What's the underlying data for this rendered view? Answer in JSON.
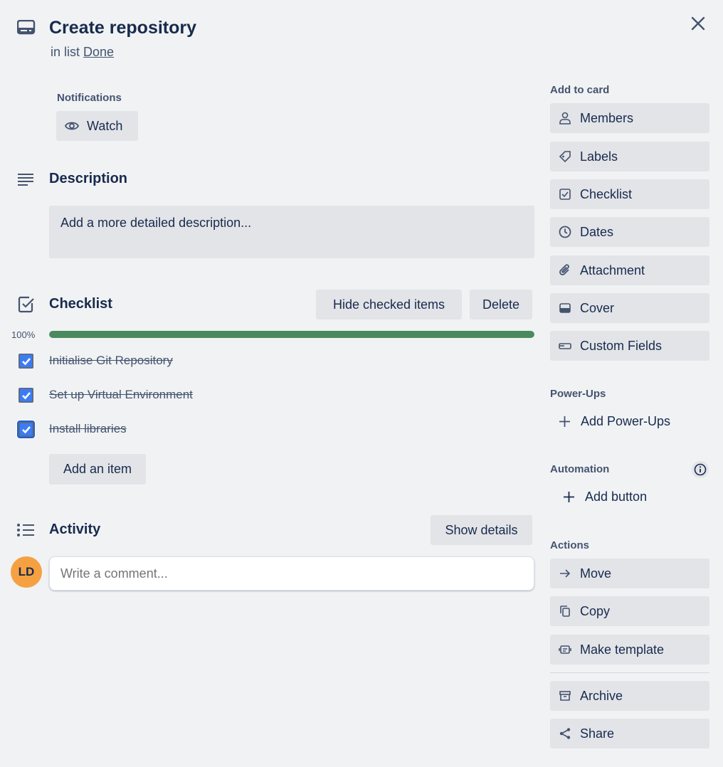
{
  "header": {
    "title": "Create repository",
    "in_list_prefix": "in list",
    "list_name": "Done"
  },
  "notifications": {
    "label": "Notifications",
    "watch": "Watch"
  },
  "description": {
    "title": "Description",
    "placeholder": "Add a more detailed description..."
  },
  "checklist": {
    "title": "Checklist",
    "hide_checked": "Hide checked items",
    "delete": "Delete",
    "progress_label": "100%",
    "progress": 100,
    "items": [
      {
        "text": "Initialise Git Repository",
        "checked": true
      },
      {
        "text": "Set up Virtual Environment",
        "checked": true
      },
      {
        "text": "Install libraries",
        "checked": true
      }
    ],
    "add_item": "Add an item"
  },
  "activity": {
    "title": "Activity",
    "show_details": "Show details",
    "avatar_initials": "LD",
    "comment_placeholder": "Write a comment..."
  },
  "sidebar": {
    "add_to_card": "Add to card",
    "add_items": [
      "Members",
      "Labels",
      "Checklist",
      "Dates",
      "Attachment",
      "Cover",
      "Custom Fields"
    ],
    "power_ups": "Power-Ups",
    "add_power_ups": "Add Power-Ups",
    "automation": "Automation",
    "add_button": "Add button",
    "actions": "Actions",
    "action_items": [
      "Move",
      "Copy",
      "Make template"
    ],
    "archive": "Archive",
    "share": "Share"
  },
  "colors": {
    "progress": "#4a8a5e",
    "checkbox": "#3b7cf6",
    "avatar": "#f5a142"
  }
}
